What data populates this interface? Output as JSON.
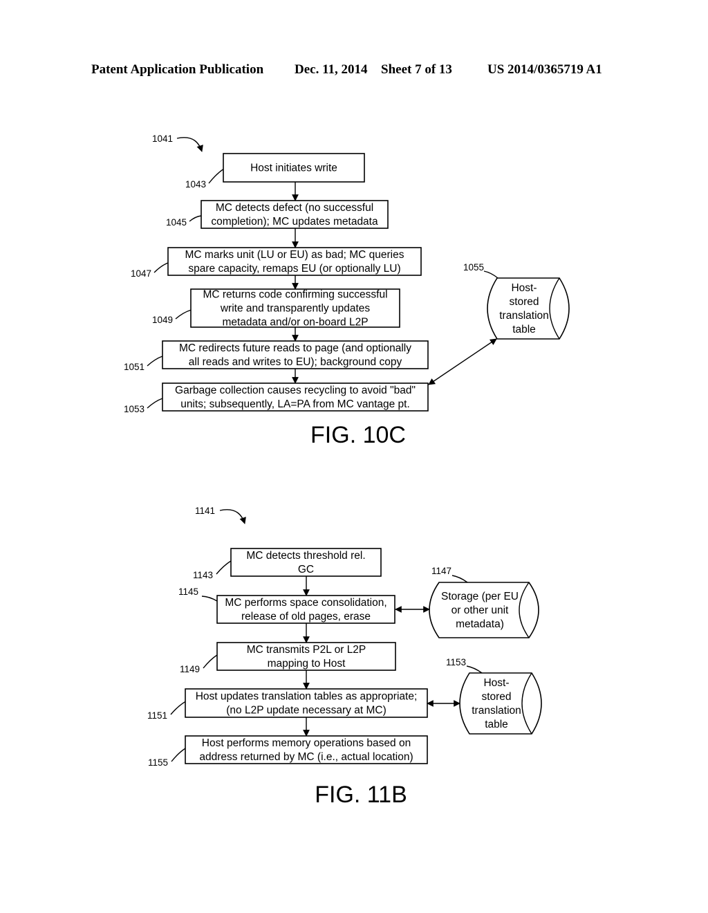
{
  "header": {
    "publication": "Patent Application Publication",
    "date": "Dec. 11, 2014",
    "sheet": "Sheet 7 of 13",
    "number": "US 2014/0365719 A1"
  },
  "figures": [
    {
      "id": "fig-10c",
      "label": "FIG. 10C",
      "ref": "1041",
      "steps": [
        {
          "ref": "1043",
          "lines": [
            "Host initiates write"
          ]
        },
        {
          "ref": "1045",
          "lines": [
            "MC detects defect (no successful",
            "completion); MC updates metadata"
          ]
        },
        {
          "ref": "1047",
          "lines": [
            "MC marks unit (LU or EU) as bad; MC queries",
            "spare capacity, remaps EU (or optionally LU)"
          ]
        },
        {
          "ref": "1049",
          "lines": [
            "MC returns code confirming successful",
            "write and transparently updates",
            "metadata and/or on-board L2P"
          ]
        },
        {
          "ref": "1051",
          "lines": [
            "MC redirects future reads to page (and optionally",
            "all reads and writes to EU); background copy"
          ]
        },
        {
          "ref": "1053",
          "lines": [
            "Garbage collection causes recycling to avoid \"bad\"",
            "units; subsequently, LA=PA from MC vantage pt."
          ]
        }
      ],
      "stores": [
        {
          "ref": "1055",
          "lines": [
            "Host-",
            "stored",
            "translation",
            "table"
          ]
        }
      ]
    },
    {
      "id": "fig-11b",
      "label": "FIG. 11B",
      "ref": "1141",
      "steps": [
        {
          "ref": "1143",
          "lines": [
            "MC detects threshold rel.",
            "GC"
          ]
        },
        {
          "ref": "1145",
          "lines": [
            "MC performs space consolidation,",
            "release of old pages, erase"
          ]
        },
        {
          "ref": "1149",
          "lines": [
            "MC transmits P2L or L2P",
            "mapping to Host"
          ]
        },
        {
          "ref": "1151",
          "lines": [
            "Host updates translation tables as appropriate;",
            "(no L2P update necessary at MC)"
          ]
        },
        {
          "ref": "1155",
          "lines": [
            "Host performs memory operations based on",
            "address returned by MC (i.e., actual location)"
          ]
        }
      ],
      "stores": [
        {
          "ref": "1147",
          "lines": [
            "Storage (per EU",
            "or other unit",
            "metadata)"
          ]
        },
        {
          "ref": "1153",
          "lines": [
            "Host-",
            "stored",
            "translation",
            "table"
          ]
        }
      ]
    }
  ]
}
